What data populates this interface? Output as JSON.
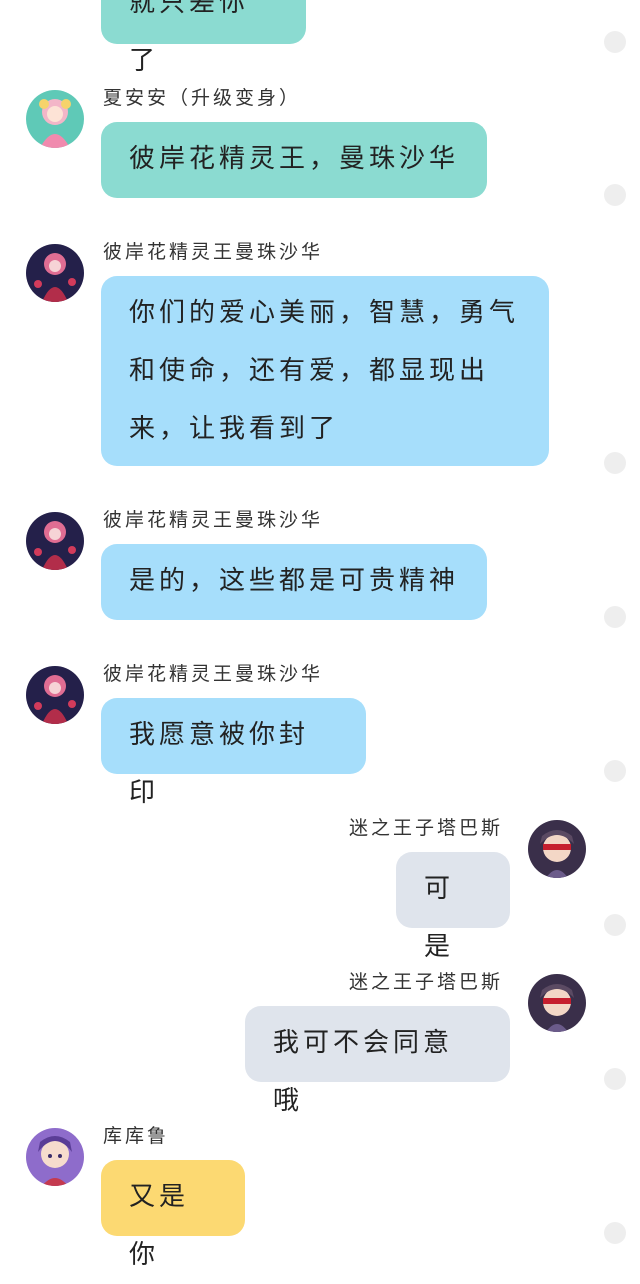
{
  "messages": [
    {
      "id": "m0",
      "sender": "",
      "text": "就只差你了",
      "side": "left",
      "color": "teal"
    },
    {
      "id": "m1",
      "sender": "夏安安（升级变身）",
      "text": "彼岸花精灵王，曼珠沙华",
      "side": "left",
      "color": "teal",
      "avatar": "girl-pink-hair-avatar"
    },
    {
      "id": "m2",
      "sender": "彼岸花精灵王曼珠沙华",
      "lines": [
        "你们的爱心美丽，智慧，勇气",
        "和使命，还有爱，都显现出",
        "来，让我看到了"
      ],
      "side": "left",
      "color": "blue",
      "avatar": "spider-lily-fairy-avatar"
    },
    {
      "id": "m3",
      "sender": "彼岸花精灵王曼珠沙华",
      "text": "是的，这些都是可贵精神",
      "side": "left",
      "color": "blue",
      "avatar": "spider-lily-fairy-avatar"
    },
    {
      "id": "m4",
      "sender": "彼岸花精灵王曼珠沙华",
      "text": "我愿意被你封印",
      "side": "left",
      "color": "blue",
      "avatar": "spider-lily-fairy-avatar"
    },
    {
      "id": "m5",
      "sender": "迷之王子塔巴斯",
      "text": "可是",
      "side": "right",
      "color": "gray",
      "avatar": "masked-prince-avatar"
    },
    {
      "id": "m6",
      "sender": "迷之王子塔巴斯",
      "text": "我可不会同意哦",
      "side": "right",
      "color": "gray",
      "avatar": "masked-prince-avatar"
    },
    {
      "id": "m7",
      "sender": "库库鲁",
      "text": "又是你",
      "side": "left",
      "color": "yellow",
      "avatar": "purple-hair-boy-avatar"
    }
  ]
}
